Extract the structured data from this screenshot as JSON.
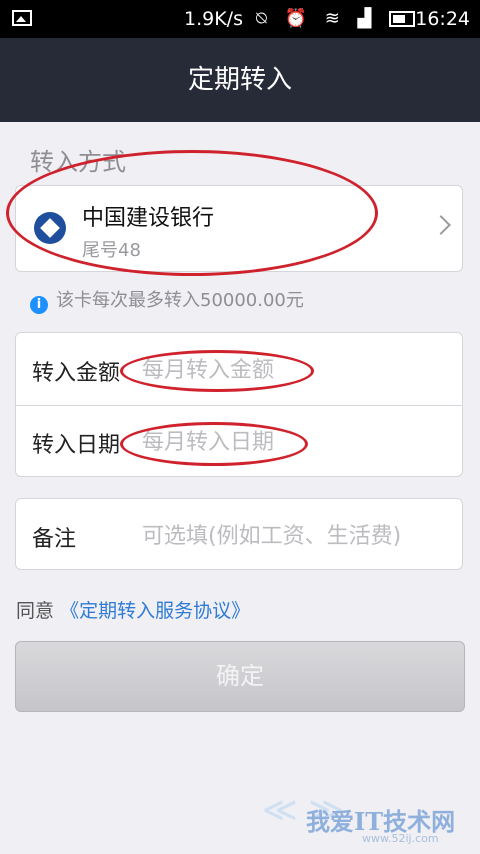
{
  "status_bar": {
    "speed": "1.9K/s",
    "time": "16:24",
    "icons": [
      "image-icon",
      "no-alarm-icon",
      "alarm-icon",
      "wifi-icon",
      "signal-icon",
      "battery-icon"
    ]
  },
  "header": {
    "title": "定期转入"
  },
  "transfer_method": {
    "section_label": "转入方式",
    "bank_name": "中国建设银行",
    "card_tail": "尾号48",
    "logo_icon": "ccb-bank-icon"
  },
  "limit_info": {
    "text": "该卡每次最多转入50000.00元"
  },
  "form": {
    "amount_label": "转入金额",
    "amount_placeholder": "每月转入金额",
    "date_label": "转入日期",
    "date_placeholder": "每月转入日期"
  },
  "note": {
    "label": "备注",
    "placeholder": "可选填(例如工资、生活费)"
  },
  "agreement": {
    "prefix": "同意",
    "link": "《定期转入服务协议》"
  },
  "confirm_button": {
    "label": "确定"
  },
  "watermark": {
    "text": "我爱IT技术网",
    "url": "www.52ij.com"
  },
  "colors": {
    "header_bg": "#272b37",
    "page_bg": "#efeff4",
    "link": "#2f7bd6",
    "annotation": "#d0222c",
    "bank_blue": "#1f4f9c"
  }
}
